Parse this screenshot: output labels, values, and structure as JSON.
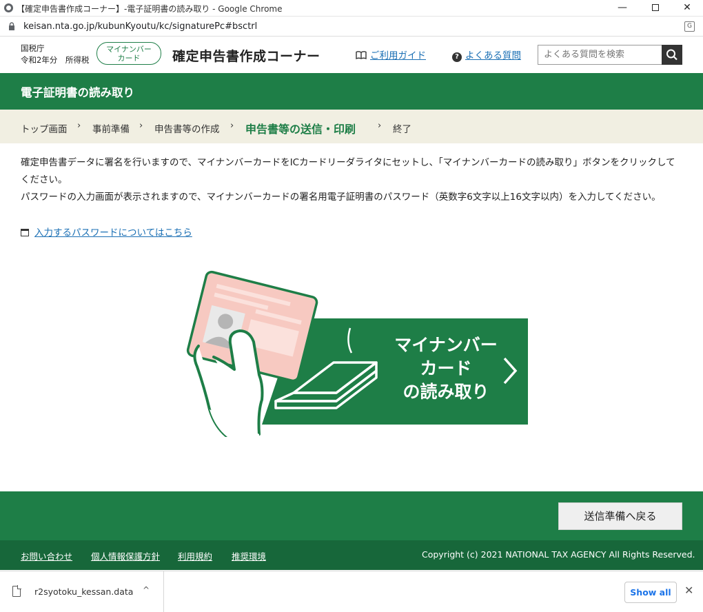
{
  "window": {
    "title": "【確定申告書作成コーナー】-電子証明書の読み取り - Google Chrome",
    "controls": {
      "minimize": "—",
      "maximize": "",
      "close": "✕"
    }
  },
  "address_bar": {
    "url": "keisan.nta.go.jp/kubunKyoutu/kc/signaturePc#bsctrl",
    "translate_label": "G"
  },
  "header": {
    "agency": "国税庁",
    "year_tax": "令和2年分　所得税",
    "mynumber_pill": {
      "line1": "マイナンバー",
      "line2": "カード"
    },
    "site_title": "確定申告書作成コーナー",
    "guide_link": "ご利用ガイド",
    "faq_link": "よくある質問",
    "faq_icon": "?",
    "search_placeholder": "よくある質問を検索"
  },
  "page": {
    "heading": "電子証明書の読み取り"
  },
  "breadcrumb": {
    "steps": [
      "トップ画面",
      "事前準備",
      "申告書等の作成",
      "申告書等の送信・印刷",
      "終了"
    ],
    "current_index": 3,
    "separator": "›"
  },
  "content": {
    "paragraph1": "確定申告書データに署名を行いますので、マイナンバーカードをICカードリーダライタにセットし、「マイナンバーカードの読み取り」ボタンをクリックしてください。",
    "paragraph2": "パスワードの入力画面が表示されますので、マイナンバーカードの署名用電子証明書のパスワード（英数字6文字以上16文字以内）を入力してください。",
    "password_link": "入力するパスワードについてはこちら"
  },
  "reader_button": {
    "line1": "マイナンバー",
    "line2": "カード",
    "line3": "の読み取り"
  },
  "footer": {
    "back_button": "送信準備へ戻る",
    "links": [
      "お問い合わせ",
      "個人情報保護方針",
      "利用規約",
      "推奨環境"
    ],
    "copyright": "Copyright (c) 2021 NATIONAL TAX AGENCY All Rights Reserved."
  },
  "downloads": {
    "file_name": "r2syotoku_kessan.data",
    "chevron": "^",
    "show_all": "Show all",
    "close": "✕"
  },
  "colors": {
    "brand_green": "#1e7e47",
    "footer_dark_green": "#17673a",
    "breadcrumb_bg": "#f1efe2",
    "link_blue": "#1a6fb4",
    "card_pink": "#f7c9c1"
  },
  "icons": [
    "globe-icon",
    "lock-icon",
    "translate-icon",
    "book-icon",
    "question-icon",
    "search-icon",
    "window-icon",
    "card-reader-icon",
    "chevron-right-icon",
    "file-icon",
    "chevron-up-icon",
    "close-icon"
  ]
}
